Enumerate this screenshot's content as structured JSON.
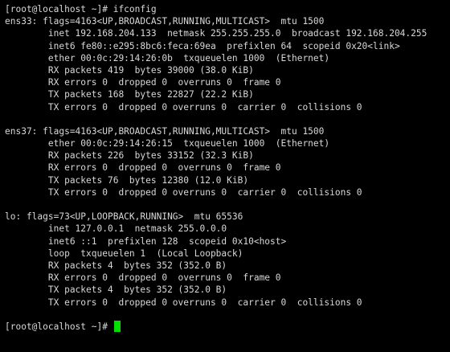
{
  "terminal": {
    "background_color": "#000000",
    "text_color": "#d8d8d8",
    "cursor_color": "#00e000",
    "lines": [
      "[root@localhost ~]# ifconfig",
      "ens33: flags=4163<UP,BROADCAST,RUNNING,MULTICAST>  mtu 1500",
      "        inet 192.168.204.133  netmask 255.255.255.0  broadcast 192.168.204.255",
      "        inet6 fe80::e295:8bc6:feca:69ea  prefixlen 64  scopeid 0x20<link>",
      "        ether 00:0c:29:14:26:0b  txqueuelen 1000  (Ethernet)",
      "        RX packets 419  bytes 39000 (38.0 KiB)",
      "        RX errors 0  dropped 0  overruns 0  frame 0",
      "        TX packets 168  bytes 22827 (22.2 KiB)",
      "        TX errors 0  dropped 0 overruns 0  carrier 0  collisions 0",
      "",
      "ens37: flags=4163<UP,BROADCAST,RUNNING,MULTICAST>  mtu 1500",
      "        ether 00:0c:29:14:26:15  txqueuelen 1000  (Ethernet)",
      "        RX packets 226  bytes 33152 (32.3 KiB)",
      "        RX errors 0  dropped 0  overruns 0  frame 0",
      "        TX packets 76  bytes 12380 (12.0 KiB)",
      "        TX errors 0  dropped 0 overruns 0  carrier 0  collisions 0",
      "",
      "lo: flags=73<UP,LOOPBACK,RUNNING>  mtu 65536",
      "        inet 127.0.0.1  netmask 255.0.0.0",
      "        inet6 ::1  prefixlen 128  scopeid 0x10<host>",
      "        loop  txqueuelen 1  (Local Loopback)",
      "        RX packets 4  bytes 352 (352.0 B)",
      "        RX errors 0  dropped 0  overruns 0  frame 0",
      "        TX packets 4  bytes 352 (352.0 B)",
      "        TX errors 0  dropped 0 overruns 0  carrier 0  collisions 0",
      ""
    ],
    "prompt": "[root@localhost ~]# "
  }
}
